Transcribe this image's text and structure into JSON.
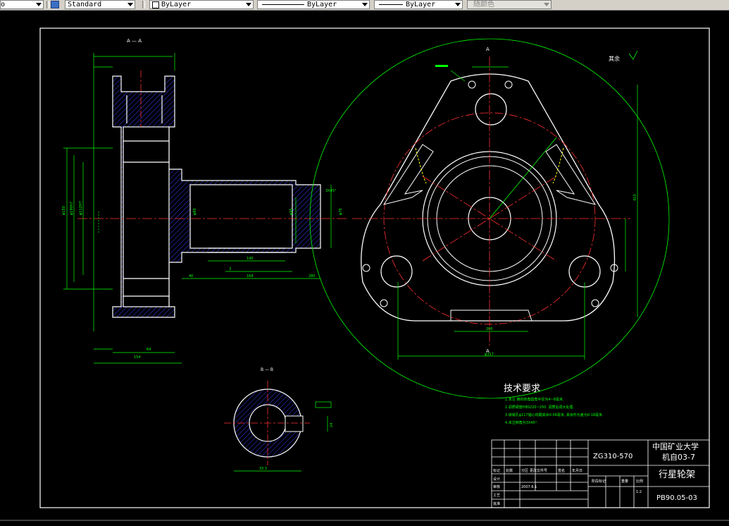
{
  "toolbar": {
    "left_partial": "o",
    "text_style": "Standard",
    "layer_color": "ByLayer",
    "linetype": "ByLayer",
    "lineweight": "ByLayer",
    "plot_style": "随颜色"
  },
  "drawing": {
    "section_aa_label": "A — A",
    "section_bb_label": "B — B",
    "section_a_top": "A",
    "section_a_bottom": "A",
    "roughness_rest": "其余",
    "tech_req_title": "技术要求",
    "tech_req_items": [
      "1.未注 铸的转角圆角半径为4~8毫米.",
      "2.调质硬度HBS220~250. 调质后调大处理.",
      "3.锁销孔φ117轴心线跟其余0.06毫米, 其余形允差为0.18毫米.",
      "4.未注倒角为3X45°."
    ],
    "title_block": {
      "university": "中国矿业大学",
      "class": "机自03-7",
      "material": "ZG310-570",
      "part_name": "行星轮架",
      "drawing_no": "PB90.05-03",
      "scale": "1:2",
      "sheet_label": "阶段标记",
      "weight_label": "重量",
      "ratio_label": "比例",
      "designer_row": "设计",
      "check_row": "审核",
      "process_row": "工艺",
      "standard_row": "标准化",
      "approve_row": "批准",
      "date": "2007.6.1",
      "marks_row": "标记",
      "count_label": "处数",
      "zone_label": "分区",
      "change_doc_label": "更改文件号",
      "signature_label": "签名",
      "ymd_label": "年月日"
    },
    "dimensions": {
      "d1": "φ150",
      "d2": "φ190h7",
      "d3": "φ112H7",
      "d4": "φ80",
      "d5": "φ95",
      "d6": "φ70",
      "d7": "154",
      "d8": "64",
      "d9": "3",
      "d10": "140",
      "d11": "40",
      "d12": "168",
      "d13": "280",
      "d14": "φ317",
      "d15": "200",
      "d16": "410",
      "d17": "φ78",
      "d18": "φ45.8",
      "d19": "3X45°",
      "d20": "24",
      "d21": "33.5"
    }
  }
}
